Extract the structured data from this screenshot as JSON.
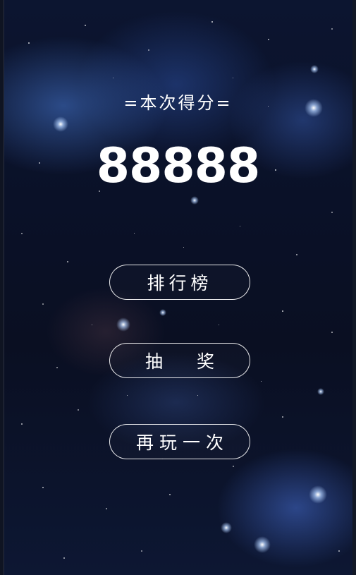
{
  "result": {
    "score_title": "=本次得分=",
    "score_value": "88888"
  },
  "buttons": {
    "leaderboard_label": "排行榜",
    "draw_label": "抽 奖",
    "replay_label": "再玩一次"
  },
  "colors": {
    "text": "#ffffff",
    "background": "#0a1128",
    "button_border": "#ffffff"
  }
}
